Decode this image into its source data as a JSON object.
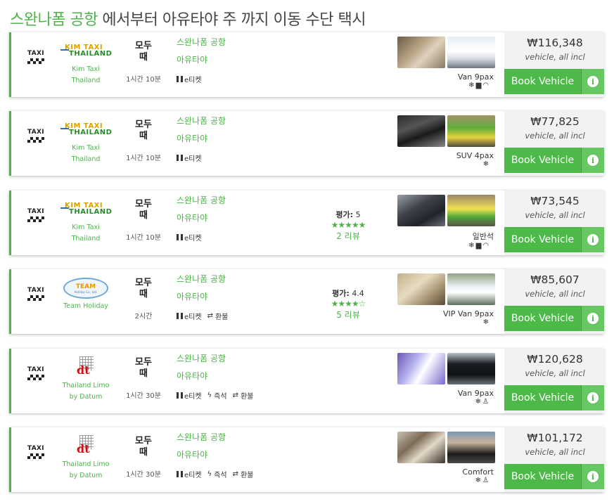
{
  "title": {
    "highlight": "스완나폼 공항",
    "rest": " 에서부터 아유타야 주 까지 이동 수단 택시"
  },
  "labels": {
    "taxi": "TAXI",
    "days": "모두 때",
    "rating_prefix": "평가:",
    "book": "Book Vehicle",
    "info": "i"
  },
  "icons": {
    "eticket": "qr-code-icon",
    "instant": "lightning-icon",
    "refund": "exchange-arrows-icon",
    "ac": "snowflake-icon",
    "luggage": "luggage-icon",
    "wifi": "wifi-icon",
    "driver": "driver-icon"
  },
  "colors": {
    "accent": "#4db548",
    "book_button": "#4cb949",
    "price_bg": "#f2f2f2"
  },
  "cards": [
    {
      "operator": [
        "Kim Taxi",
        "Thailand"
      ],
      "logo": "kim",
      "duration": "1시간 10분",
      "route_from": "스완나폼 공항",
      "route_to": "아유타야",
      "features": [
        "e티켓"
      ],
      "rating": null,
      "vehicle": "Van 9pax",
      "amenities": [
        "❄",
        "🧳",
        "wifi"
      ],
      "price": "₩116,348",
      "price_note": "vehicle, all incl",
      "images": [
        "img-int-a",
        "img-ext-a"
      ]
    },
    {
      "operator": [
        "Kim Taxi",
        "Thailand"
      ],
      "logo": "kim",
      "duration": "1시간 10분",
      "route_from": "스완나폼 공항",
      "route_to": "아유타야",
      "features": [
        "e티켓"
      ],
      "rating": null,
      "vehicle": "SUV 4pax",
      "amenities": [
        "❄"
      ],
      "price": "₩77,825",
      "price_note": "vehicle, all incl",
      "images": [
        "img-int-b",
        "img-ext-b"
      ]
    },
    {
      "operator": [
        "Kim Taxi",
        "Thailand"
      ],
      "logo": "kim",
      "duration": "1시간 10분",
      "route_from": "스완나폼 공항",
      "route_to": "아유타야",
      "features": [
        "e티켓"
      ],
      "rating": {
        "score": "5",
        "stars": "★★★★★",
        "reviews": "2 리뷰"
      },
      "vehicle": "일반석",
      "amenities": [
        "❄",
        "🧳",
        "wifi"
      ],
      "price": "₩73,545",
      "price_note": "vehicle, all incl",
      "images": [
        "img-int-c",
        "img-ext-c"
      ]
    },
    {
      "operator": [
        "Team Holiday"
      ],
      "logo": "team",
      "duration": "2시간",
      "route_from": "스완나폼 공항",
      "route_to": "아유타야",
      "features": [
        "e티켓",
        "환불"
      ],
      "rating": {
        "score": "4.4",
        "stars": "★★★★☆",
        "reviews": "5 리뷰"
      },
      "vehicle": "VIP Van 9pax",
      "amenities": [
        "❄"
      ],
      "price": "₩85,607",
      "price_note": "vehicle, all incl",
      "images": [
        "img-int-d",
        "img-ext-d"
      ]
    },
    {
      "operator": [
        "Thailand Limo",
        "by Datum"
      ],
      "logo": "limo",
      "duration": "1시간 30분",
      "route_from": "스완나폼 공항",
      "route_to": "아유타야",
      "features": [
        "e티켓",
        "즉석",
        "환불"
      ],
      "rating": null,
      "vehicle": "Van 9pax",
      "amenities": [
        "❄",
        "driver"
      ],
      "price": "₩120,628",
      "price_note": "vehicle, all incl",
      "images": [
        "img-int-e",
        "img-ext-e"
      ]
    },
    {
      "operator": [
        "Thailand Limo",
        "by Datum"
      ],
      "logo": "limo",
      "duration": "1시간 30분",
      "route_from": "스완나폼 공항",
      "route_to": "아유타야",
      "features": [
        "e티켓",
        "즉석",
        "환불"
      ],
      "rating": null,
      "vehicle": "Comfort",
      "amenities": [
        "❄",
        "driver"
      ],
      "price": "₩101,172",
      "price_note": "vehicle, all incl",
      "images": [
        "img-int-f",
        "img-ext-f"
      ]
    }
  ]
}
